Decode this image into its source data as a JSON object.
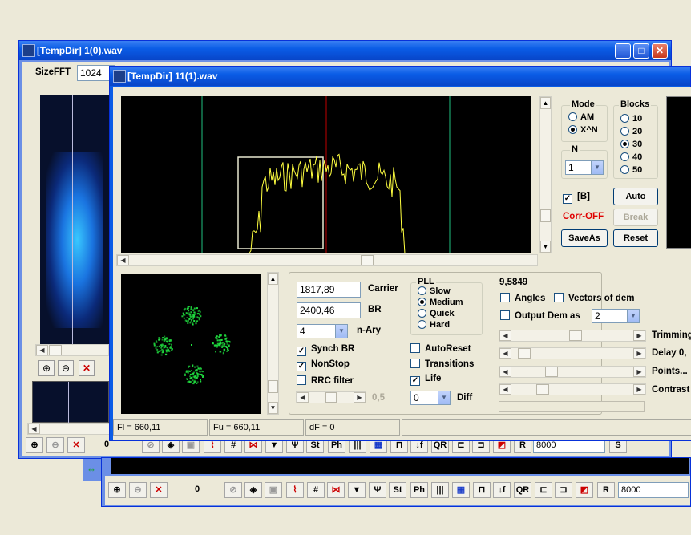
{
  "background_window": {
    "title": "[TempDir] 1(0).wav",
    "sizefft_label": "SizeFFT",
    "sizefft_value": "1024",
    "toolbar": {
      "counter": "0",
      "buttons": [
        "zoom-in",
        "zoom-out",
        "delete",
        "stop",
        "sound",
        "frame",
        "spectrum",
        "grid",
        "chart",
        "down-arrow",
        "antenna",
        "St",
        "Ph",
        "bars",
        "table",
        "pulse",
        "step",
        "QR",
        "hold",
        "wave",
        "mark",
        "R"
      ],
      "rate_value": "8000",
      "s_label": "S"
    }
  },
  "bottom_window": {
    "toolbar": {
      "counter": "0",
      "rate_value": "8000",
      "r_label": "R"
    }
  },
  "main_window": {
    "title": "[TempDir] 11(1).wav",
    "mode": {
      "title": "Mode",
      "options": [
        "AM",
        "X^N"
      ],
      "selected": "X^N"
    },
    "blocks": {
      "title": "Blocks",
      "options": [
        "10",
        "20",
        "30",
        "40",
        "50"
      ],
      "selected": "30"
    },
    "n_group": {
      "title": "N",
      "value": "1"
    },
    "b_checkbox": {
      "label": "[B]",
      "checked": true
    },
    "corr_status": "Corr-OFF",
    "buttons": {
      "auto": "Auto",
      "break": "Break",
      "saveas": "SaveAs",
      "reset": "Reset"
    },
    "demod": {
      "carrier_value": "1817,89",
      "carrier_label": "Carrier",
      "br_value": "2400,46",
      "br_label": "BR",
      "nary_value": "4",
      "nary_label": "n-Ary",
      "synch_br": {
        "label": "Synch BR",
        "checked": true
      },
      "nonstop": {
        "label": "NonStop",
        "checked": true
      },
      "rrc_filter": {
        "label": "RRC filter",
        "checked": false
      },
      "rrc_value": "0,5",
      "pll": {
        "title": "PLL",
        "options": [
          "Slow",
          "Medium",
          "Quick",
          "Hard"
        ],
        "selected": "Medium"
      },
      "autoreset": {
        "label": "AutoReset",
        "checked": false
      },
      "transitions": {
        "label": "Transitions",
        "checked": false
      },
      "life": {
        "label": "Life",
        "checked": true
      },
      "diff_value": "0",
      "diff_label": "Diff"
    },
    "right_panel": {
      "value": "9,5849",
      "angles": {
        "label": "Angles",
        "checked": false
      },
      "vectors": {
        "label": "Vectors of dem",
        "checked": false
      },
      "output_dem": {
        "label": "Output Dem as",
        "checked": false
      },
      "output_value": "2",
      "sliders": [
        {
          "label": "Trimming",
          "level": 0.52
        },
        {
          "label": "Delay  0,",
          "level": 0.05
        },
        {
          "label": "Points...",
          "level": 0.3
        },
        {
          "label": "Contrast",
          "level": 0.22
        }
      ]
    },
    "status": {
      "fl": "Fl = 660,11",
      "fu": "Fu = 660,11",
      "df": "dF = 0"
    },
    "colors": {
      "spectrum_trace": "#ffff40",
      "center_marker": "#c00000",
      "side_marker": "#20c080",
      "constellation": "#20e040",
      "corr_off": "#e00000"
    }
  }
}
